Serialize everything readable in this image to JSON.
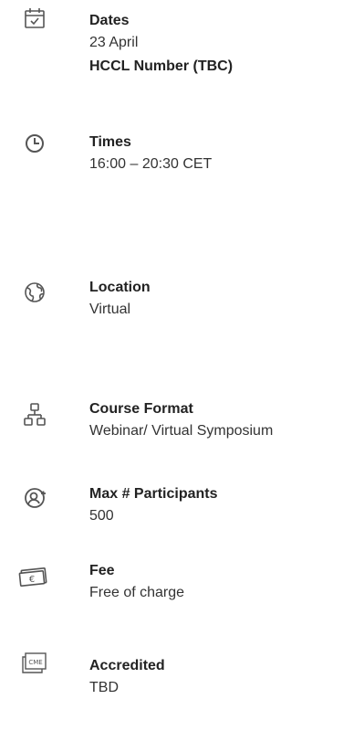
{
  "colors": {
    "icon": "#555555",
    "text": "#333333",
    "label": "#222222"
  },
  "items": [
    {
      "icon": "calendar-icon",
      "label": "Dates",
      "values": [
        "23 April",
        "HCCL Number (TBC)"
      ]
    },
    {
      "icon": "clock-icon",
      "label": "Times",
      "values": [
        "16:00 – 20:30 CET"
      ]
    },
    {
      "icon": "globe-icon",
      "label": "Location",
      "values": [
        "Virtual"
      ]
    },
    {
      "icon": "hierarchy-icon",
      "label": "Course Format",
      "values": [
        "Webinar/ Virtual Symposium"
      ]
    },
    {
      "icon": "user-plus-icon",
      "label": "Max # Participants",
      "values": [
        "500"
      ]
    },
    {
      "icon": "euro-banknote-icon",
      "label": "Fee",
      "values": [
        "Free of charge"
      ]
    },
    {
      "icon": "cme-certificate-icon",
      "label": "Accredited",
      "values": [
        "TBD"
      ]
    }
  ],
  "icon_texts": {
    "cme": "CME",
    "euro": "€"
  }
}
